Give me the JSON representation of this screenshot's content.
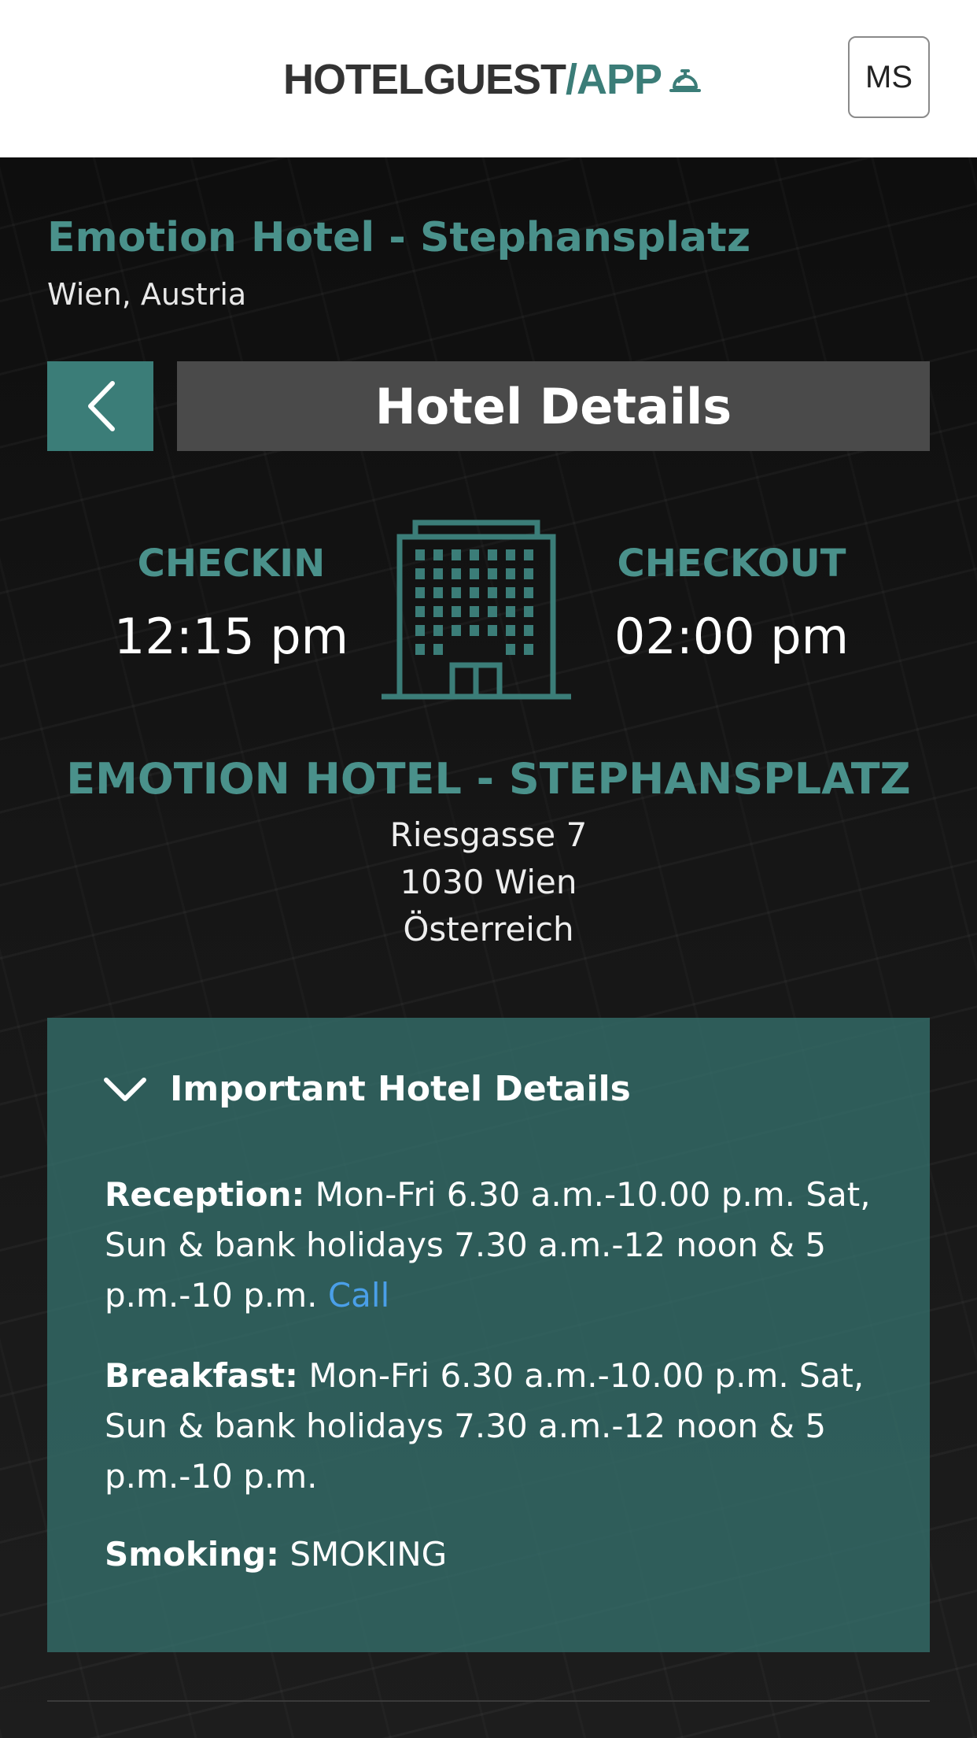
{
  "header": {
    "logo_part1": "HOTELGUEST",
    "logo_part2": "/APP",
    "user_initials": "MS"
  },
  "hotel": {
    "name": "Emotion Hotel - Stephansplatz",
    "location": "Wien, Austria"
  },
  "page": {
    "title": "Hotel Details"
  },
  "times": {
    "checkin_label": "CHECKIN",
    "checkin_time": "12:15 pm",
    "checkout_label": "CHECKOUT",
    "checkout_time": "02:00 pm"
  },
  "address": {
    "name": "EMOTION HOTEL - STEPHANSPLATZ",
    "street": "Riesgasse 7",
    "city": "1030 Wien",
    "country": "Österreich"
  },
  "details": {
    "heading": "Important Hotel Details",
    "reception_label": "Reception:",
    "reception_text": "Mon-Fri 6.30 a.m.-10.00 p.m. Sat, Sun & bank holidays 7.30 a.m.-12 noon & 5 p.m.-10 p.m.",
    "call_link": "Call",
    "breakfast_label": "Breakfast:",
    "breakfast_text": "Mon-Fri 6.30 a.m.-10.00 p.m. Sat, Sun & bank holidays 7.30 a.m.-12 noon & 5 p.m.-10 p.m.",
    "smoking_label": "Smoking:",
    "smoking_text": "SMOKING"
  },
  "colors": {
    "accent": "#3b7d78",
    "accent_text": "#4a918b",
    "link": "#4a9fe8",
    "title_bar": "#4a4a4a"
  }
}
